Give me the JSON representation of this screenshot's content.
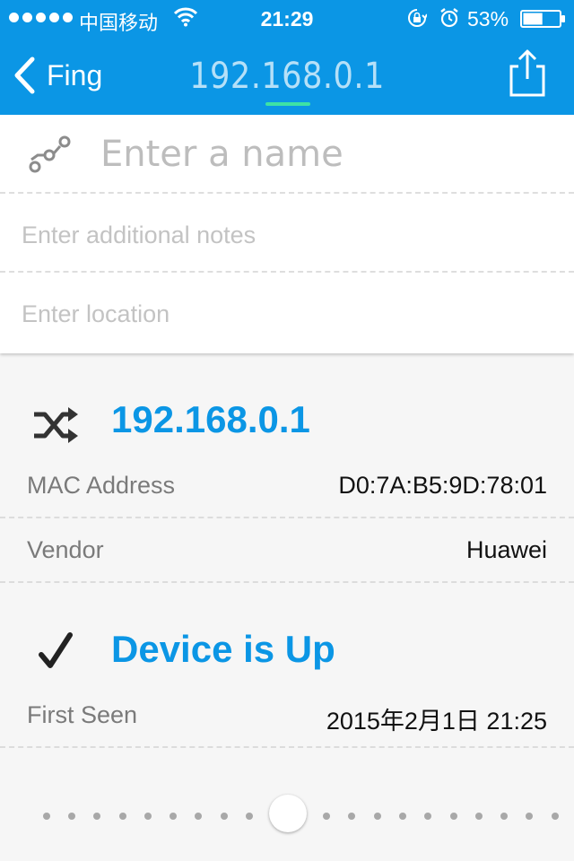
{
  "status_bar": {
    "carrier": "中国移动",
    "time": "21:29",
    "battery_percent": "53%",
    "battery_level": 0.53,
    "icons": [
      "wifi-icon",
      "orientation-lock-icon",
      "alarm-icon",
      "battery-icon"
    ]
  },
  "nav": {
    "back_label": "Fing",
    "title": "192.168.0.1",
    "share_icon": "share-icon"
  },
  "form": {
    "name_placeholder": "Enter a name",
    "notes_placeholder": "Enter additional notes",
    "location_placeholder": "Enter location",
    "name_icon": "device-tag-icon"
  },
  "network": {
    "icon": "shuffle-icon",
    "ip": "192.168.0.1",
    "rows": [
      {
        "label": "MAC Address",
        "value": "D0:7A:B5:9D:78:01"
      },
      {
        "label": "Vendor",
        "value": "Huawei"
      }
    ]
  },
  "status": {
    "icon": "checkmark-icon",
    "title": "Device is Up",
    "rows": [
      {
        "label": "First Seen",
        "value": "2015年2月1日 21:25"
      }
    ]
  },
  "page_control": {
    "active_index": 9,
    "total": 20
  },
  "colors": {
    "accent": "#0b96e5",
    "nav_title": "#b5e0f8",
    "indicator": "#3ee2a5",
    "background": "#f6f6f6"
  }
}
